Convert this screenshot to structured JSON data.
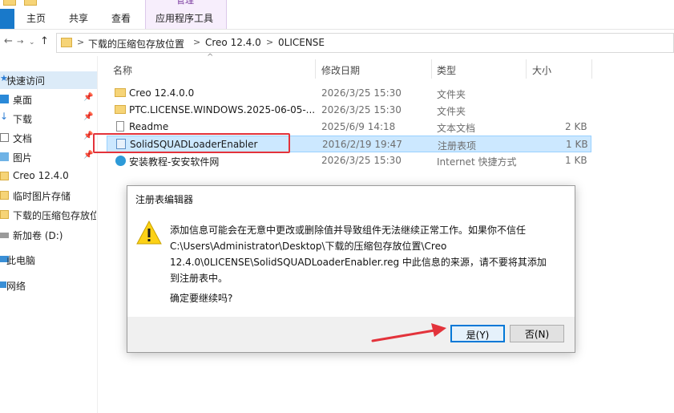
{
  "ribbon": {
    "tabs": [
      "主页",
      "共享",
      "查看"
    ],
    "context_group_label": "管理",
    "context_tab": "应用程序工具"
  },
  "address": {
    "crumbs": [
      "下载的压缩包存放位置",
      "Creo 12.4.0",
      "0LICENSE"
    ],
    "separator": ">"
  },
  "nav": {
    "items": [
      {
        "label": "快速访问",
        "icon": "star-icon",
        "pinned": false
      },
      {
        "label": "桌面",
        "icon": "desktop-icon",
        "pinned": true
      },
      {
        "label": "下载",
        "icon": "download-icon",
        "pinned": true
      },
      {
        "label": "文档",
        "icon": "document-icon",
        "pinned": true
      },
      {
        "label": "图片",
        "icon": "picture-icon",
        "pinned": true
      },
      {
        "label": "Creo 12.4.0",
        "icon": "folder-icon",
        "pinned": false
      },
      {
        "label": "临时图片存储",
        "icon": "folder-icon",
        "pinned": false
      },
      {
        "label": "下载的压缩包存放位",
        "icon": "folder-icon",
        "pinned": false
      },
      {
        "label": "新加卷 (D:)",
        "icon": "drive-icon",
        "pinned": false
      },
      {
        "label": "此电脑",
        "icon": "computer-icon",
        "pinned": false
      },
      {
        "label": "网络",
        "icon": "network-icon",
        "pinned": false
      }
    ]
  },
  "columns": {
    "name": "名称",
    "date": "修改日期",
    "type": "类型",
    "size": "大小"
  },
  "files": [
    {
      "name": "Creo 12.4.0.0",
      "date": "2026/3/25 15:30",
      "type": "文件夹",
      "size": "",
      "icon": "folder-icon"
    },
    {
      "name": "PTC.LICENSE.WINDOWS.2025-06-05-...",
      "date": "2026/3/25 15:30",
      "type": "文件夹",
      "size": "",
      "icon": "folder-icon"
    },
    {
      "name": "Readme",
      "date": "2025/6/9 14:18",
      "type": "文本文档",
      "size": "2 KB",
      "icon": "text-file-icon"
    },
    {
      "name": "SolidSQUADLoaderEnabler",
      "date": "2016/2/19 19:47",
      "type": "注册表项",
      "size": "1 KB",
      "icon": "registry-file-icon"
    },
    {
      "name": "安装教程-安安软件网",
      "date": "2026/3/25 15:30",
      "type": "Internet 快捷方式",
      "size": "1 KB",
      "icon": "internet-shortcut-icon"
    }
  ],
  "dialog": {
    "title": "注册表编辑器",
    "message": "添加信息可能会在无意中更改或删除值并导致组件无法继续正常工作。如果你不信任 C:\\Users\\Administrator\\Desktop\\下载的压缩包存放位置\\Creo 12.4.0\\0LICENSE\\SolidSQUADLoaderEnabler.reg 中此信息的来源，请不要将其添加到注册表中。",
    "question": "确定要继续吗?",
    "yes_label": "是(Y)",
    "no_label": "否(N)"
  },
  "colors": {
    "annotation_red": "#e3333b",
    "accent_blue": "#0078d7",
    "selection": "#cce8ff"
  }
}
